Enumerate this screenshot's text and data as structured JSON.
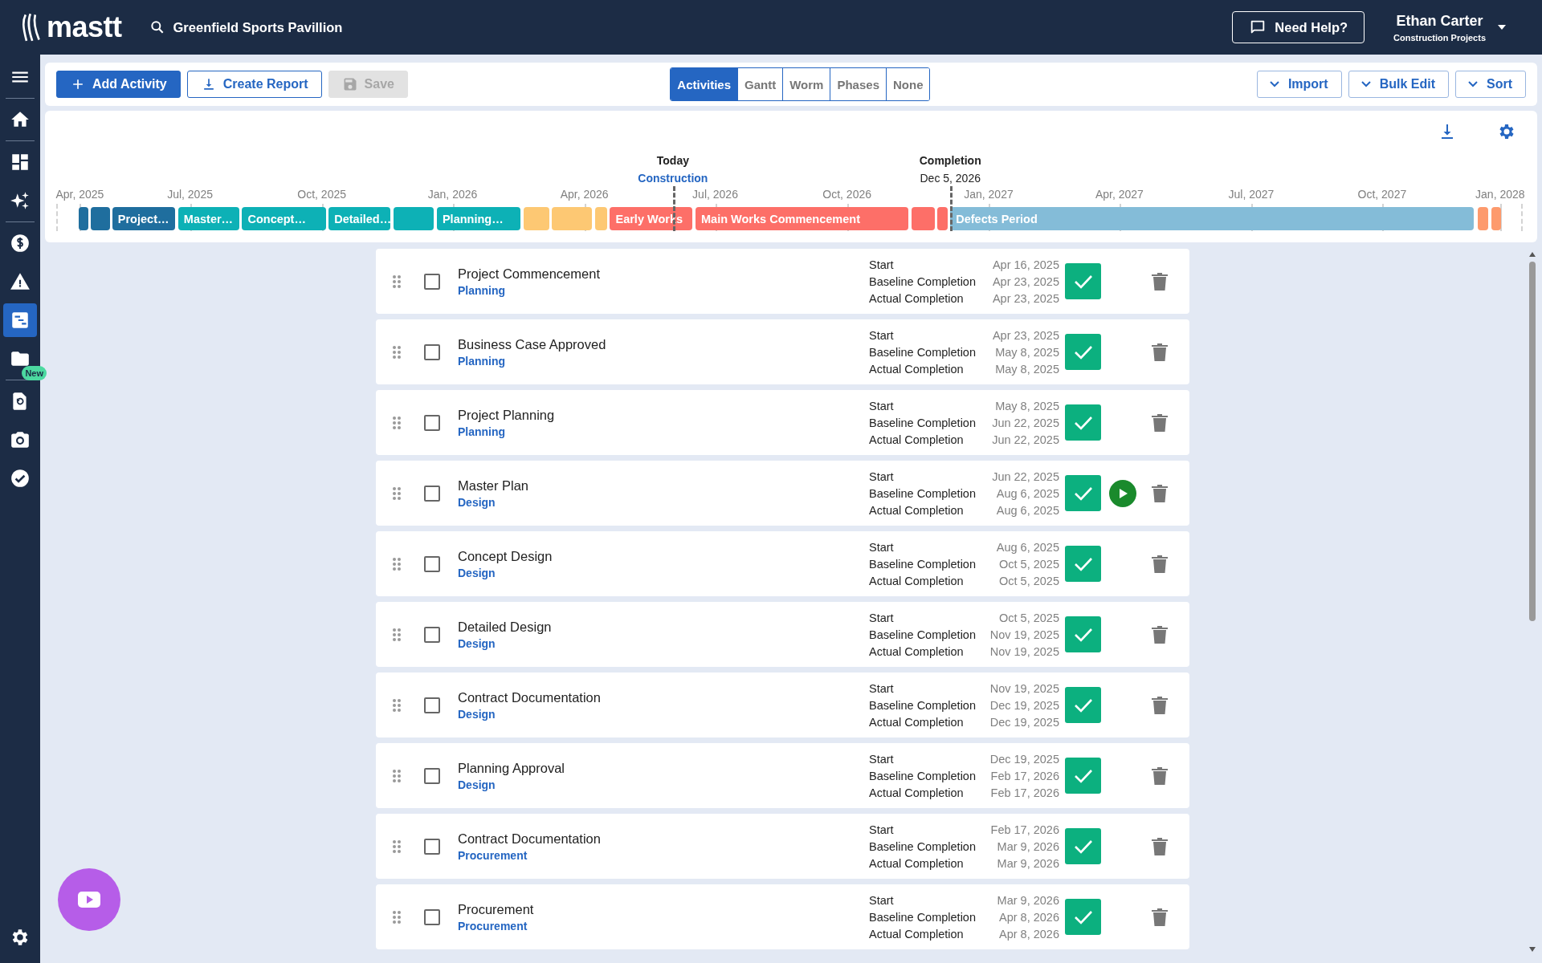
{
  "header": {
    "logo": "mastt",
    "project": "Greenfield Sports Pavillion",
    "help_button": "Need Help?",
    "user": {
      "name": "Ethan Carter",
      "subtitle": "Construction Projects"
    }
  },
  "sidebar": {
    "items": [
      {
        "kind": "menu",
        "selected": false
      },
      {
        "kind": "home",
        "selected": false
      },
      {
        "kind": "dashboard",
        "selected": false
      },
      {
        "kind": "sparkle",
        "selected": false
      },
      {
        "kind": "dollar",
        "selected": false
      },
      {
        "kind": "warning",
        "selected": false
      },
      {
        "kind": "gantt",
        "selected": true
      },
      {
        "kind": "folder",
        "selected": false,
        "badge": "New"
      },
      {
        "kind": "document",
        "selected": false
      },
      {
        "kind": "camera",
        "selected": false
      },
      {
        "kind": "check",
        "selected": false
      },
      {
        "kind": "settings",
        "selected": false
      }
    ]
  },
  "toolbar": {
    "actions": [
      {
        "kind": "add",
        "label": "Add Activity",
        "disabled": false
      },
      {
        "kind": "report",
        "label": "Create Report",
        "disabled": false
      },
      {
        "kind": "save",
        "label": "Save",
        "disabled": true
      }
    ],
    "views": [
      {
        "label": "Activities",
        "selected": true
      },
      {
        "label": "Gantt",
        "selected": false
      },
      {
        "label": "Worm",
        "selected": false
      },
      {
        "label": "Phases",
        "selected": false
      },
      {
        "label": "None",
        "selected": false
      }
    ],
    "menus": [
      "Import",
      "Bulk Edit",
      "Sort"
    ]
  },
  "timeline": {
    "ticks": [
      "Apr, 2025",
      "Jul, 2025",
      "Oct, 2025",
      "Jan, 2026",
      "Apr, 2026",
      "Jul, 2026",
      "Oct, 2026",
      "Jan, 2027",
      "Apr, 2027",
      "Jul, 2027",
      "Oct, 2027",
      "Jan, 2028"
    ],
    "markers": [
      {
        "kind": "today",
        "title": "Today",
        "subtitle": "Construction"
      },
      {
        "kind": "completion",
        "title": "Completion",
        "subtitle": "Dec 5, 2026"
      }
    ],
    "segments": [
      {
        "color": "#1f6e9e"
      },
      {
        "color": "#1f6e9e"
      },
      {
        "label": "Project…",
        "color": "#1f6e9e"
      },
      {
        "label": "Master…",
        "color": "#0db1b6"
      },
      {
        "label": "Concept…",
        "color": "#0db1b6"
      },
      {
        "label": "Detailed…",
        "color": "#0db1b6"
      },
      {
        "color": "#0db1b6"
      },
      {
        "label": "Planning…",
        "color": "#0db1b6"
      },
      {
        "color": "#fdc873"
      },
      {
        "color": "#fdc873"
      },
      {
        "color": "#fdc873"
      },
      {
        "label": "Early Works",
        "color": "#fd6f68"
      },
      {
        "label": "Main Works Commencement",
        "color": "#fd6f68"
      },
      {
        "color": "#fd6f68"
      },
      {
        "color": "#fd6f68"
      },
      {
        "label": "Defects Period",
        "color": "#84bcd8"
      },
      {
        "color": "#fd9a6d"
      },
      {
        "color": "#fd9a6d"
      }
    ]
  },
  "activities": [
    {
      "name": "Project Commencement",
      "phase": "Planning",
      "checked": false,
      "done": true,
      "play": false,
      "dates": [
        {
          "label": "Start",
          "value": "Apr 16, 2025"
        },
        {
          "label": "Baseline Completion",
          "value": "Apr 23, 2025"
        },
        {
          "label": "Actual Completion",
          "value": "Apr 23, 2025"
        }
      ]
    },
    {
      "name": "Business Case Approved",
      "phase": "Planning",
      "checked": false,
      "done": true,
      "play": false,
      "dates": [
        {
          "label": "Start",
          "value": "Apr 23, 2025"
        },
        {
          "label": "Baseline Completion",
          "value": "May 8, 2025"
        },
        {
          "label": "Actual Completion",
          "value": "May 8, 2025"
        }
      ]
    },
    {
      "name": "Project Planning",
      "phase": "Planning",
      "checked": false,
      "done": true,
      "play": false,
      "dates": [
        {
          "label": "Start",
          "value": "May 8, 2025"
        },
        {
          "label": "Baseline Completion",
          "value": "Jun 22, 2025"
        },
        {
          "label": "Actual Completion",
          "value": "Jun 22, 2025"
        }
      ]
    },
    {
      "name": "Master Plan",
      "phase": "Design",
      "checked": false,
      "done": true,
      "play": true,
      "dates": [
        {
          "label": "Start",
          "value": "Jun 22, 2025"
        },
        {
          "label": "Baseline Completion",
          "value": "Aug 6, 2025"
        },
        {
          "label": "Actual Completion",
          "value": "Aug 6, 2025"
        }
      ]
    },
    {
      "name": "Concept Design",
      "phase": "Design",
      "checked": false,
      "done": true,
      "play": false,
      "dates": [
        {
          "label": "Start",
          "value": "Aug 6, 2025"
        },
        {
          "label": "Baseline Completion",
          "value": "Oct 5, 2025"
        },
        {
          "label": "Actual Completion",
          "value": "Oct 5, 2025"
        }
      ]
    },
    {
      "name": "Detailed Design",
      "phase": "Design",
      "checked": false,
      "done": true,
      "play": false,
      "dates": [
        {
          "label": "Start",
          "value": "Oct 5, 2025"
        },
        {
          "label": "Baseline Completion",
          "value": "Nov 19, 2025"
        },
        {
          "label": "Actual Completion",
          "value": "Nov 19, 2025"
        }
      ]
    },
    {
      "name": "Contract Documentation",
      "phase": "Design",
      "checked": false,
      "done": true,
      "play": false,
      "dates": [
        {
          "label": "Start",
          "value": "Nov 19, 2025"
        },
        {
          "label": "Baseline Completion",
          "value": "Dec 19, 2025"
        },
        {
          "label": "Actual Completion",
          "value": "Dec 19, 2025"
        }
      ]
    },
    {
      "name": "Planning Approval",
      "phase": "Design",
      "checked": false,
      "done": true,
      "play": false,
      "dates": [
        {
          "label": "Start",
          "value": "Dec 19, 2025"
        },
        {
          "label": "Baseline Completion",
          "value": "Feb 17, 2026"
        },
        {
          "label": "Actual Completion",
          "value": "Feb 17, 2026"
        }
      ]
    },
    {
      "name": "Contract Documentation",
      "phase": "Procurement",
      "checked": false,
      "done": true,
      "play": false,
      "dates": [
        {
          "label": "Start",
          "value": "Feb 17, 2026"
        },
        {
          "label": "Baseline Completion",
          "value": "Mar 9, 2026"
        },
        {
          "label": "Actual Completion",
          "value": "Mar 9, 2026"
        }
      ]
    },
    {
      "name": "Procurement",
      "phase": "Procurement",
      "checked": false,
      "done": true,
      "play": false,
      "dates": [
        {
          "label": "Start",
          "value": "Mar 9, 2026"
        },
        {
          "label": "Baseline Completion",
          "value": "Apr 8, 2026"
        },
        {
          "label": "Actual Completion",
          "value": "Apr 8, 2026"
        }
      ]
    }
  ]
}
